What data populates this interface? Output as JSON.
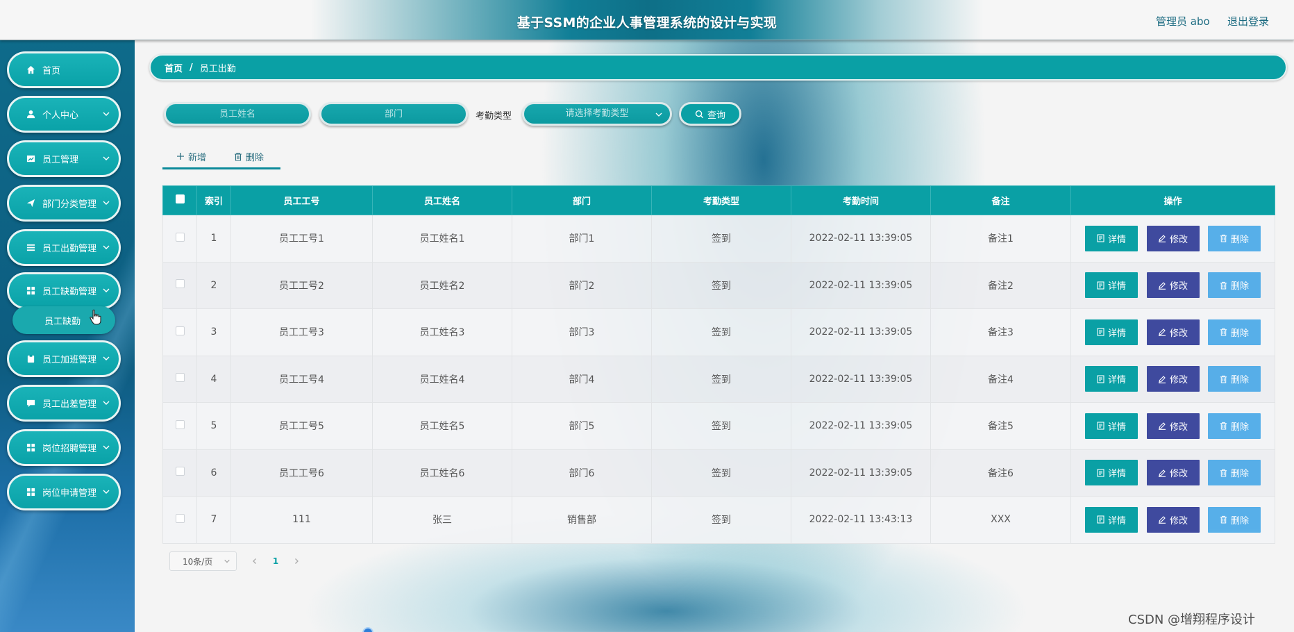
{
  "header": {
    "title": "基于SSM的企业人事管理系统的设计与实现",
    "user": "管理员 abo",
    "logout": "退出登录"
  },
  "sidebar": {
    "items": [
      {
        "label": "首页",
        "icon": "home-icon",
        "has_chevron": false
      },
      {
        "label": "个人中心",
        "icon": "user-icon",
        "has_chevron": true
      },
      {
        "label": "员工管理",
        "icon": "chart-icon",
        "has_chevron": true
      },
      {
        "label": "部门分类管理",
        "icon": "send-icon",
        "has_chevron": true
      },
      {
        "label": "员工出勤管理",
        "icon": "list-icon",
        "has_chevron": true
      },
      {
        "label": "员工缺勤管理",
        "icon": "grid-icon",
        "has_chevron": true
      },
      {
        "label": "员工加班管理",
        "icon": "clipboard-icon",
        "has_chevron": true
      },
      {
        "label": "员工出差管理",
        "icon": "message-icon",
        "has_chevron": true
      },
      {
        "label": "岗位招聘管理",
        "icon": "grid-icon",
        "has_chevron": true
      },
      {
        "label": "岗位申请管理",
        "icon": "grid-icon",
        "has_chevron": true
      }
    ],
    "submenu": {
      "label": "员工缺勤"
    }
  },
  "breadcrumb": {
    "home": "首页",
    "separator": "/",
    "current": "员工出勤"
  },
  "search": {
    "name_placeholder": "员工姓名",
    "dept_placeholder": "部门",
    "type_label": "考勤类型",
    "type_placeholder": "请选择考勤类型",
    "query_label": "查询"
  },
  "toolbar": {
    "add_label": "新增",
    "delete_label": "删除"
  },
  "table": {
    "headers": [
      "索引",
      "员工工号",
      "员工姓名",
      "部门",
      "考勤类型",
      "考勤时间",
      "备注",
      "操作"
    ],
    "rows": [
      {
        "index": "1",
        "emp_no": "员工工号1",
        "emp_name": "员工姓名1",
        "dept": "部门1",
        "type": "签到",
        "time": "2022-02-11 13:39:05",
        "note": "备注1"
      },
      {
        "index": "2",
        "emp_no": "员工工号2",
        "emp_name": "员工姓名2",
        "dept": "部门2",
        "type": "签到",
        "time": "2022-02-11 13:39:05",
        "note": "备注2"
      },
      {
        "index": "3",
        "emp_no": "员工工号3",
        "emp_name": "员工姓名3",
        "dept": "部门3",
        "type": "签到",
        "time": "2022-02-11 13:39:05",
        "note": "备注3"
      },
      {
        "index": "4",
        "emp_no": "员工工号4",
        "emp_name": "员工姓名4",
        "dept": "部门4",
        "type": "签到",
        "time": "2022-02-11 13:39:05",
        "note": "备注4"
      },
      {
        "index": "5",
        "emp_no": "员工工号5",
        "emp_name": "员工姓名5",
        "dept": "部门5",
        "type": "签到",
        "time": "2022-02-11 13:39:05",
        "note": "备注5"
      },
      {
        "index": "6",
        "emp_no": "员工工号6",
        "emp_name": "员工姓名6",
        "dept": "部门6",
        "type": "签到",
        "time": "2022-02-11 13:39:05",
        "note": "备注6"
      },
      {
        "index": "7",
        "emp_no": "111",
        "emp_name": "张三",
        "dept": "销售部",
        "type": "签到",
        "time": "2022-02-11 13:43:13",
        "note": "XXX"
      }
    ],
    "actions": {
      "detail": "详情",
      "edit": "修改",
      "delete": "删除"
    }
  },
  "pagination": {
    "page_size": "10条/页",
    "current_page": "1"
  },
  "watermark": "CSDN @增翔程序设计",
  "colors": {
    "accent": "#0aa0a5",
    "edit": "#3f4a9e",
    "delete": "#47a8e8",
    "sidebar": "#0d5c80"
  }
}
